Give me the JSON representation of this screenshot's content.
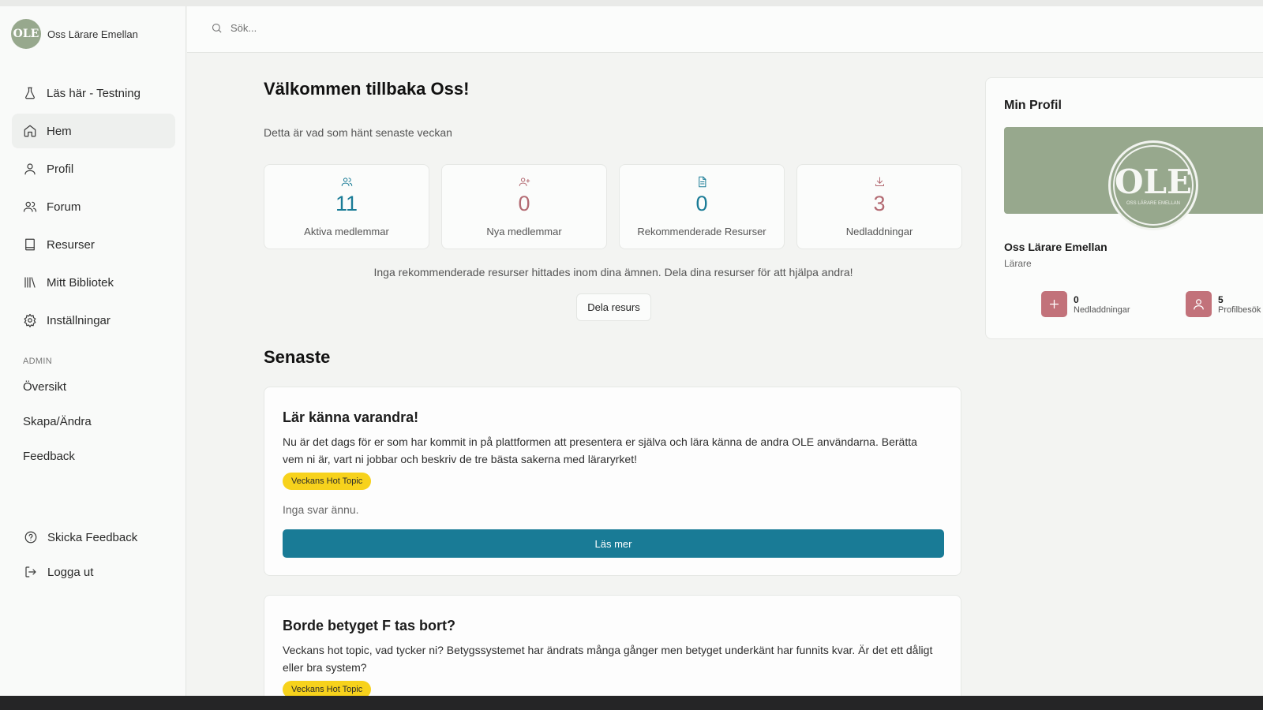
{
  "brand": {
    "name": "Oss Lärare Emellan",
    "logo_text": "OLE"
  },
  "search": {
    "placeholder": "Sök..."
  },
  "sidebar": {
    "items": [
      {
        "label": "Läs här - Testning",
        "icon": "flask-icon"
      },
      {
        "label": "Hem",
        "icon": "home-icon",
        "active": true
      },
      {
        "label": "Profil",
        "icon": "user-icon"
      },
      {
        "label": "Forum",
        "icon": "users-icon"
      },
      {
        "label": "Resurser",
        "icon": "book-icon"
      },
      {
        "label": "Mitt Bibliotek",
        "icon": "library-icon"
      },
      {
        "label": "Inställningar",
        "icon": "gear-icon"
      }
    ],
    "admin_label": "ADMIN",
    "admin_items": [
      "Översikt",
      "Skapa/Ändra",
      "Feedback"
    ],
    "bottom_items": [
      {
        "label": "Skicka Feedback",
        "icon": "help-circle-icon"
      },
      {
        "label": "Logga ut",
        "icon": "logout-icon"
      }
    ]
  },
  "main": {
    "welcome": "Välkommen tillbaka Oss!",
    "subtitle": "Detta är vad som hänt senaste veckan",
    "stats": [
      {
        "value": "11",
        "label": "Aktiva medlemmar",
        "icon": "users-icon",
        "color": "#197b96"
      },
      {
        "value": "0",
        "label": "Nya medlemmar",
        "icon": "user-plus-icon",
        "color": "#b36a72"
      },
      {
        "value": "0",
        "label": "Rekommenderade Resurser",
        "icon": "document-icon",
        "color": "#197b96"
      },
      {
        "value": "3",
        "label": "Nedladdningar",
        "icon": "download-icon",
        "color": "#b36a72"
      }
    ],
    "no_results": "Inga rekommenderade resurser hittades inom dina ämnen. Dela dina resurser för att hjälpa andra!",
    "share_button": "Dela resurs",
    "latest_title": "Senaste",
    "posts": [
      {
        "title": "Lär känna varandra!",
        "body": "Nu är det dags för er som har kommit in på plattformen att presentera er själva och lära känna de andra OLE användarna. Berätta vem ni är, vart ni jobbar och beskriv de tre bästa sakerna med läraryrket!",
        "badge": "Veckans Hot Topic",
        "replies": "Inga svar ännu.",
        "button": "Läs mer"
      },
      {
        "title": "Borde betyget F tas bort?",
        "body": "Veckans hot topic, vad tycker ni? Betygssystemet har ändrats många gånger men betyget underkänt har funnits kvar. Är det ett dåligt eller bra system?",
        "badge": "Veckans Hot Topic"
      }
    ]
  },
  "profile": {
    "title": "Min Profil",
    "avatar_logo": "OLE",
    "avatar_sub": "OSS LÄRARE EMELLAN",
    "name": "Oss Lärare Emellan",
    "role": "Lärare",
    "stats": [
      {
        "value": "0",
        "label": "Nedladdningar",
        "icon": "plus-icon"
      },
      {
        "value": "5",
        "label": "Profilbesök",
        "icon": "user-icon"
      }
    ]
  },
  "colors": {
    "accent": "#197b96",
    "rose": "#b36a72",
    "sage": "#97a88d",
    "badge": "#f7d21c"
  }
}
